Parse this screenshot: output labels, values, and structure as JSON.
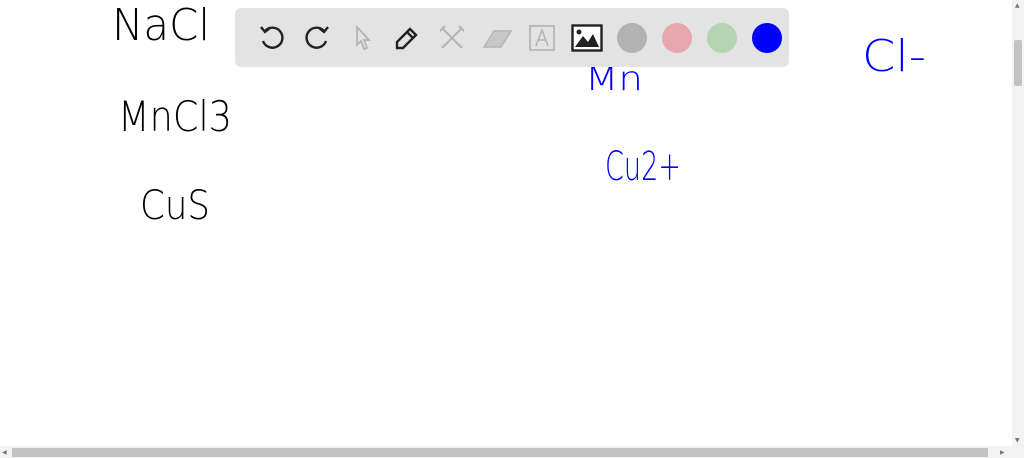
{
  "canvas": {
    "ink_black": "#000000",
    "ink_blue": "#0000ff",
    "handwriting": {
      "nacl": "NaCl",
      "mncl3": "MnCl3",
      "cus": "CuS",
      "mn": "Mn",
      "cu2plus": "Cu2+",
      "cl_minus": "Cl-"
    }
  },
  "toolbar": {
    "tools": [
      {
        "name": "undo-icon",
        "enabled": true
      },
      {
        "name": "redo-icon",
        "enabled": true
      },
      {
        "name": "select-pointer-icon",
        "enabled": false
      },
      {
        "name": "pen-icon",
        "enabled": true,
        "selected": true
      },
      {
        "name": "tools-icon",
        "enabled": false
      },
      {
        "name": "eraser-icon",
        "enabled": false
      },
      {
        "name": "text-icon",
        "enabled": false
      },
      {
        "name": "image-icon",
        "enabled": true
      }
    ],
    "colors": [
      {
        "name": "gray",
        "hex": "#b3b3b3"
      },
      {
        "name": "pink",
        "hex": "#e6a8ae"
      },
      {
        "name": "green",
        "hex": "#b5d5b2"
      },
      {
        "name": "blue",
        "hex": "#0000ff",
        "selected": true
      }
    ]
  }
}
